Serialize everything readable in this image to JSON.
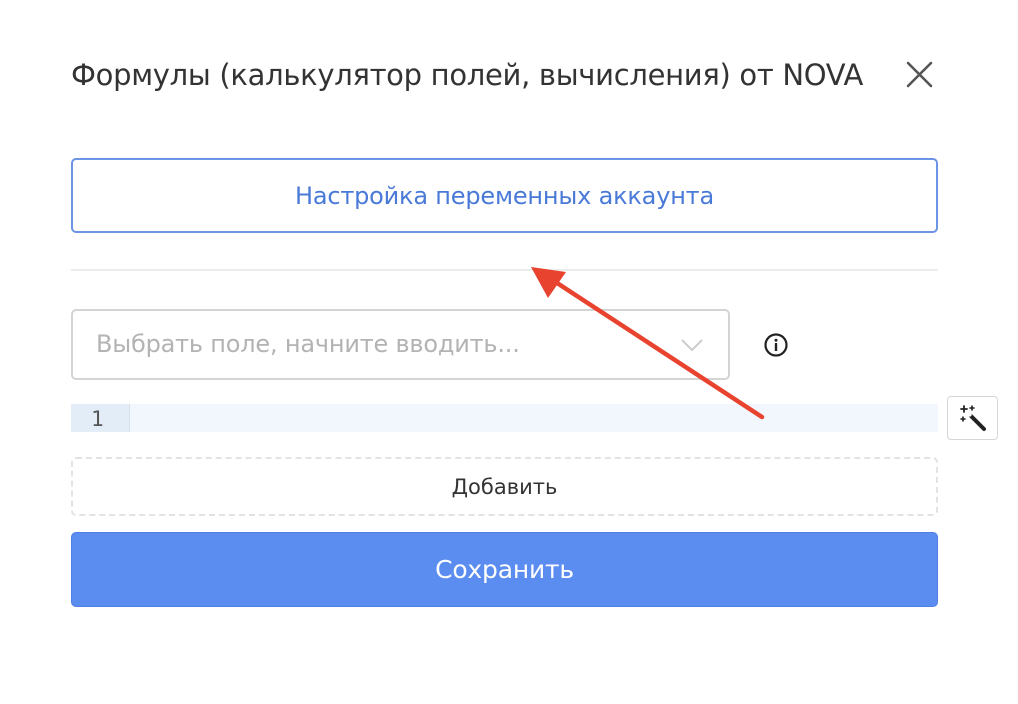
{
  "dialog": {
    "title": "Формулы (калькулятор полей, вычисления) от NOVA"
  },
  "variables_button": {
    "label": "Настройка переменных аккаунта"
  },
  "field_select": {
    "placeholder": "Выбрать поле, начните вводить..."
  },
  "editor": {
    "line_numbers": [
      "1"
    ]
  },
  "add_button": {
    "label": "Добавить"
  },
  "save_button": {
    "label": "Сохранить"
  },
  "icons": {
    "close": "close-icon",
    "chevron": "chevron-down-icon",
    "info": "info-icon",
    "magic": "magic-wand-icon"
  },
  "colors": {
    "accent": "#5b8cef",
    "accent_text": "#4a7ad8",
    "annotation_arrow": "#e8432f",
    "editor_bg": "#f1f7fc"
  }
}
